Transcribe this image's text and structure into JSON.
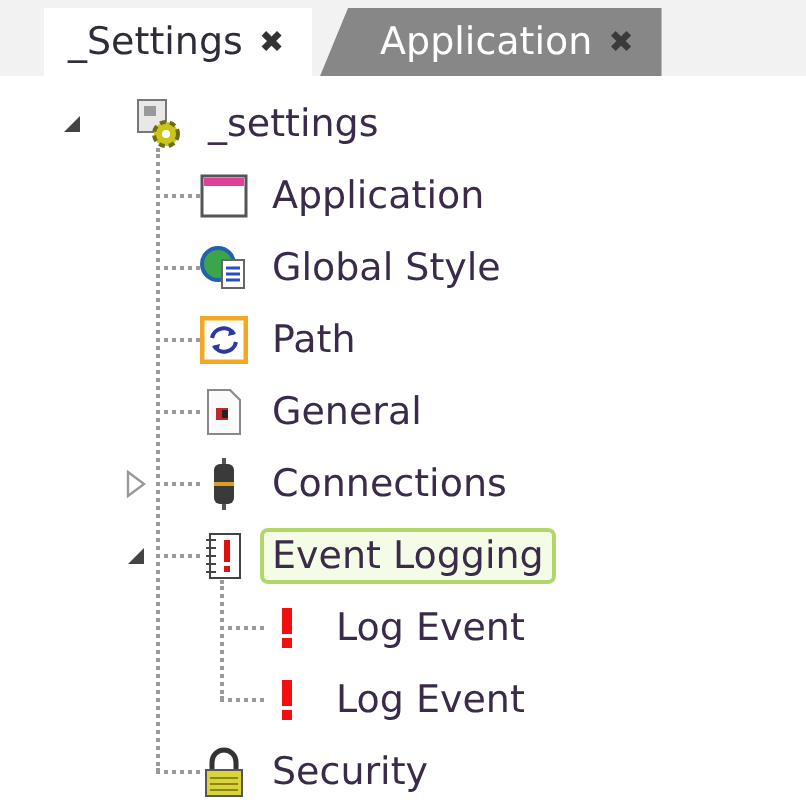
{
  "tabs": [
    {
      "label": "_Settings",
      "selected": true,
      "close": "✖"
    },
    {
      "label": "Application",
      "selected": false,
      "close": "✖"
    }
  ],
  "tree": [
    {
      "label": "_settings",
      "kind": "settings",
      "expanded": true,
      "selected": false,
      "children": [
        {
          "label": "Application",
          "kind": "window",
          "selected": false
        },
        {
          "label": "Global Style",
          "kind": "style",
          "selected": false
        },
        {
          "label": "Path",
          "kind": "path",
          "selected": false
        },
        {
          "label": "General",
          "kind": "document",
          "selected": false
        },
        {
          "label": "Connections",
          "kind": "connection",
          "expanded": false,
          "selected": false
        },
        {
          "label": "Event Logging",
          "kind": "log",
          "expanded": true,
          "selected": true,
          "children": [
            {
              "label": "Log Event",
              "kind": "event",
              "selected": false
            },
            {
              "label": "Log Event",
              "kind": "event",
              "selected": false
            }
          ]
        },
        {
          "label": "Security",
          "kind": "security",
          "selected": false
        }
      ]
    }
  ]
}
